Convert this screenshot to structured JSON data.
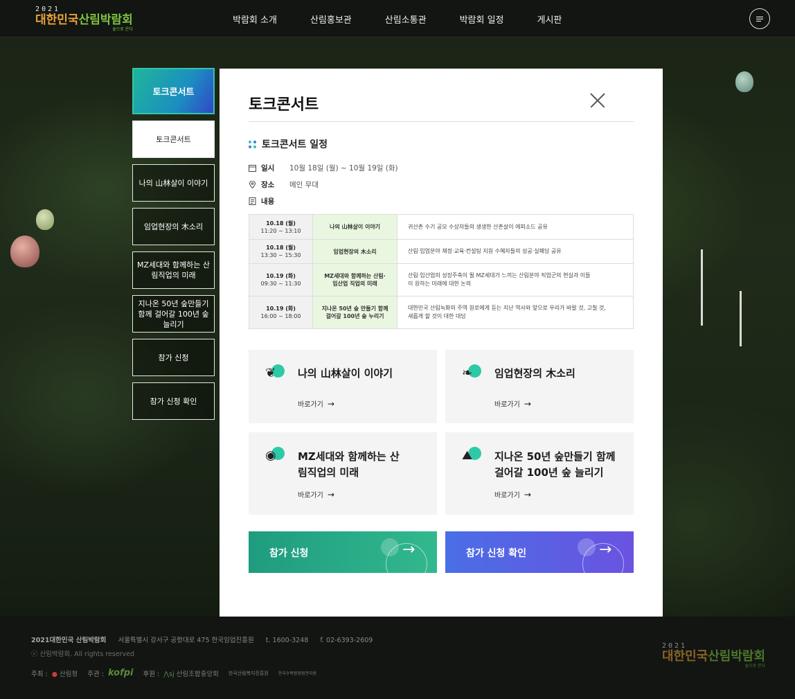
{
  "header": {
    "logo": {
      "year": "2021",
      "name_a": "대한민국",
      "name_b": "산림박람회",
      "sub": "숲으로 온다"
    },
    "nav": [
      "박람회 소개",
      "산림홍보관",
      "산림소통관",
      "박람회 일정",
      "게시판"
    ]
  },
  "side": {
    "title": "토크콘서트",
    "items": [
      "토크콘서트",
      "나의 山林살이 이야기",
      "임업현장의 木소리",
      "MZ세대와 함께하는 산림직업의 미래",
      "지나온 50년 숲만들기 함께 걸어갈 100년 숲 늘리기",
      "참가 신청",
      "참가 신청 확인"
    ]
  },
  "modal": {
    "title": "토크콘서트",
    "section_title": "토크콘서트 일정",
    "info": [
      {
        "label": "일시",
        "value": "10월 18일 (월) ~ 10월 19일 (화)"
      },
      {
        "label": "장소",
        "value": "메인 무대"
      },
      {
        "label": "내용",
        "value": ""
      }
    ],
    "schedule": [
      {
        "date": "10.18 (월)",
        "time": "11:20 ~ 13:10",
        "session": "나의 山林살이 이야기",
        "desc": "귀산촌 수기 공모 수상자들의 생생한 산촌살이 에피소드 공유"
      },
      {
        "date": "10.18 (월)",
        "time": "13:30 ~ 15:30",
        "session": "임업현장의 木소리",
        "desc": "산림·임업분야 재정·교육·컨설팅 지원 수혜자들의 성공·실패담 공유"
      },
      {
        "date": "10.19 (화)",
        "time": "09:30 ~ 11:30",
        "session": "MZ세대와 함께하는 산림·임산업 직업의 미래",
        "desc": "산림·임산업의 성장주축이 될 MZ세대가 느끼는 산림분야 직업군의 현실과 이들이 원하는 미래에 대한 논의"
      },
      {
        "date": "10.19 (화)",
        "time": "16:00 ~ 18:00",
        "session": "지나온 50년 숲 만들기 함께 걸어갈 100년 숲 누리기",
        "desc": "대한민국 산림녹화의 주역 원로에게 듣는 지난 역사와 앞으로 우리가 바랄 것, 고칠 것, 새롭게 할 것이 대한 대담"
      }
    ],
    "cards": [
      {
        "title": "나의 山林살이 이야기",
        "link": "바로가기"
      },
      {
        "title": "임업현장의 木소리",
        "link": "바로가기"
      },
      {
        "title": "MZ세대와 함께하는 산림직업의 미래",
        "link": "바로가기"
      },
      {
        "title": "지나온 50년 숲만들기 함께 걸어갈 100년 숲 늘리기",
        "link": "바로가기"
      }
    ],
    "cta": [
      {
        "label": "참가 신청"
      },
      {
        "label": "참가 신청 확인"
      }
    ]
  },
  "footer": {
    "org": "2021대한민국 산림박람회",
    "address": "서울특별시 강서구 공항대로 475 한국임업진흥원",
    "tel": "t. 1600-3248",
    "fax": "f. 02-6393-2609",
    "copyright": "ⓒ 산림박람회. All rights reserved",
    "host_label": "주최 :",
    "host": "산림청",
    "organizer_label": "주관 :",
    "organizer": "kofpi",
    "sponsor_label": "후원 :",
    "sponsors": [
      "산림조합중앙회",
      "한국산림복지진흥원",
      "한국수목원정원관리원"
    ]
  },
  "colors": {
    "accent_green": "#2ec9a6",
    "cta_green": "#1fa07e",
    "cta_blue": "#4b5ee8"
  }
}
